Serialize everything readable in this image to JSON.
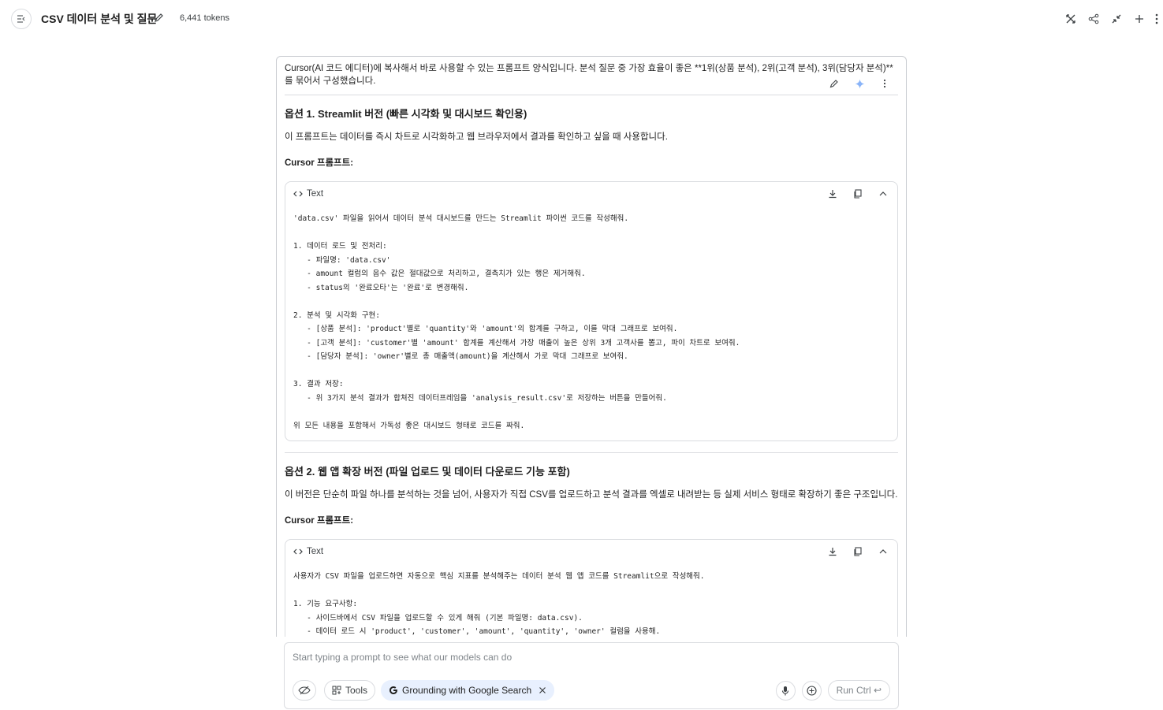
{
  "header": {
    "title": "CSV 데이터 분석 및 질문",
    "tokens": "6,441 tokens"
  },
  "message": {
    "intro": "Cursor(AI 코드 에디터)에 복사해서 바로 사용할 수 있는 프롬프트 양식입니다. 분석 질문 중 가장 효율이 좋은 **1위(상품 분석), 2위(고객 분석), 3위(담당자 분석)**를 묶어서 구성했습니다.",
    "option1": {
      "heading": "옵션 1. Streamlit 버전 (빠른 시각화 및 대시보드 확인용)",
      "desc": "이 프롬프트는 데이터를 즉시 차트로 시각화하고 웹 브라우저에서 결과를 확인하고 싶을 때 사용합니다.",
      "label": "Cursor 프롬프트:",
      "code_lang": "Text",
      "code_lines": [
        "'data.csv' 파일을 읽어서 데이터 분석 대시보드를 만드는 Streamlit 파이썬 코드를 작성해줘.",
        "",
        "1. 데이터 로드 및 전처리:",
        "   - 파일명: 'data.csv'",
        "   - amount 컬럼의 음수 값은 절대값으로 처리하고, 결측치가 있는 행은 제거해줘.",
        "   - status의 '완료오타'는 '완료'로 변경해줘.",
        "",
        "2. 분석 및 시각화 구현:",
        "   - [상품 분석]: 'product'별로 'quantity'와 'amount'의 합계를 구하고, 이를 막대 그래프로 보여줘.",
        "   - [고객 분석]: 'customer'별 'amount' 합계를 계산해서 가장 매출이 높은 상위 3개 고객사를 뽑고, 파이 차트로 보여줘.",
        "   - [담당자 분석]: 'owner'별로 총 매출액(amount)을 계산해서 가로 막대 그래프로 보여줘.",
        "",
        "3. 결과 저장:",
        "   - 위 3가지 분석 결과가 합쳐진 데이터프레임을 'analysis_result.csv'로 저장하는 버튼을 만들어줘.",
        "",
        "위 모든 내용을 포함해서 가독성 좋은 대시보드 형태로 코드를 짜줘."
      ]
    },
    "option2": {
      "heading": "옵션 2. 웹 앱 확장 버전 (파일 업로드 및 데이터 다운로드 기능 포함)",
      "desc": "이 버전은 단순히 파일 하나를 분석하는 것을 넘어, 사용자가 직접 CSV를 업로드하고 분석 결과를 엑셀로 내려받는 등 실제 서비스 형태로 확장하기 좋은 구조입니다.",
      "label": "Cursor 프롬프트:",
      "code_lang": "Text",
      "code_lines": [
        "사용자가 CSV 파일을 업로드하면 자동으로 핵심 지표를 분석해주는 데이터 분석 웹 앱 코드를 Streamlit으로 작성해줘.",
        "",
        "1. 기능 요구사항:",
        "   - 사이드바에서 CSV 파일을 업로드할 수 있게 해줘 (기본 파일명: data.csv).",
        "   - 데이터 로드 시 'product', 'customer', 'amount', 'quantity', 'owner' 컬럼을 사용해."
      ]
    }
  },
  "composer": {
    "placeholder": "Start typing a prompt to see what our models can do",
    "tools_label": "Tools",
    "grounding_label": "Grounding with Google Search",
    "run_label": "Run Ctrl ↩"
  }
}
